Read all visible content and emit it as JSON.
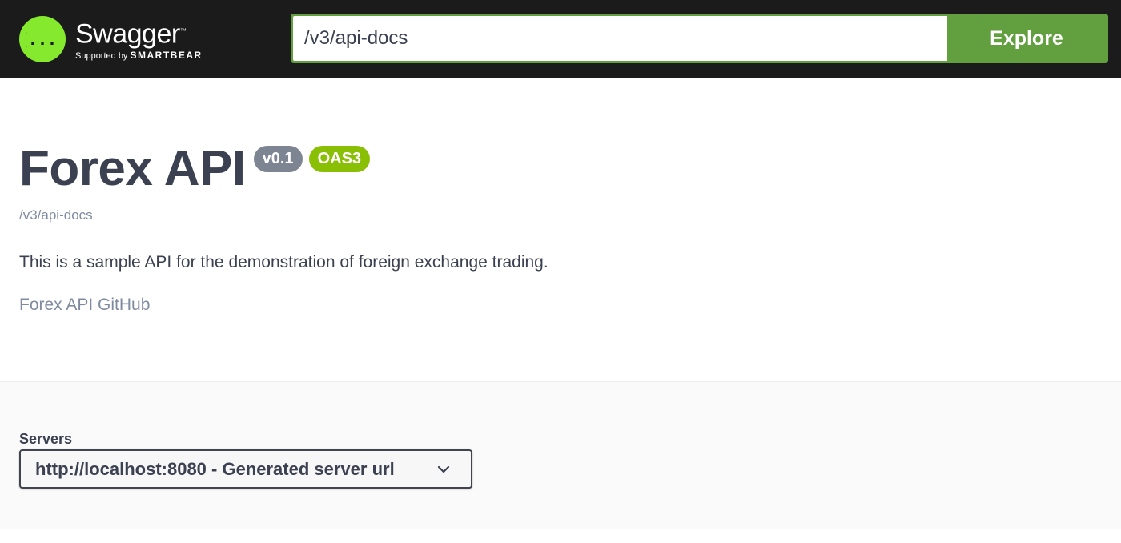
{
  "topbar": {
    "logo_word": "Swagger",
    "logo_tm": "™",
    "logo_sub_prefix": "Supported by ",
    "logo_sub_brand": "SMARTBEAR",
    "logo_icon_text": "{...}",
    "url_value": "/v3/api-docs",
    "explore_label": "Explore"
  },
  "info": {
    "title": "Forex API",
    "version": "v0.1",
    "oas_badge": "OAS3",
    "spec_url": "/v3/api-docs",
    "description": "This is a sample API for the demonstration of foreign exchange trading.",
    "github_link": "Forex API GitHub"
  },
  "servers": {
    "label": "Servers",
    "selected": "http://localhost:8080 - Generated server url"
  },
  "colors": {
    "topbar_bg": "#1b1b1b",
    "logo_green": "#85ea2d",
    "explore_green": "#62a03f",
    "version_badge": "#7d8492",
    "oas_badge": "#89bf04",
    "link_gray": "#7f8ba0",
    "text_dark": "#3b4151"
  }
}
